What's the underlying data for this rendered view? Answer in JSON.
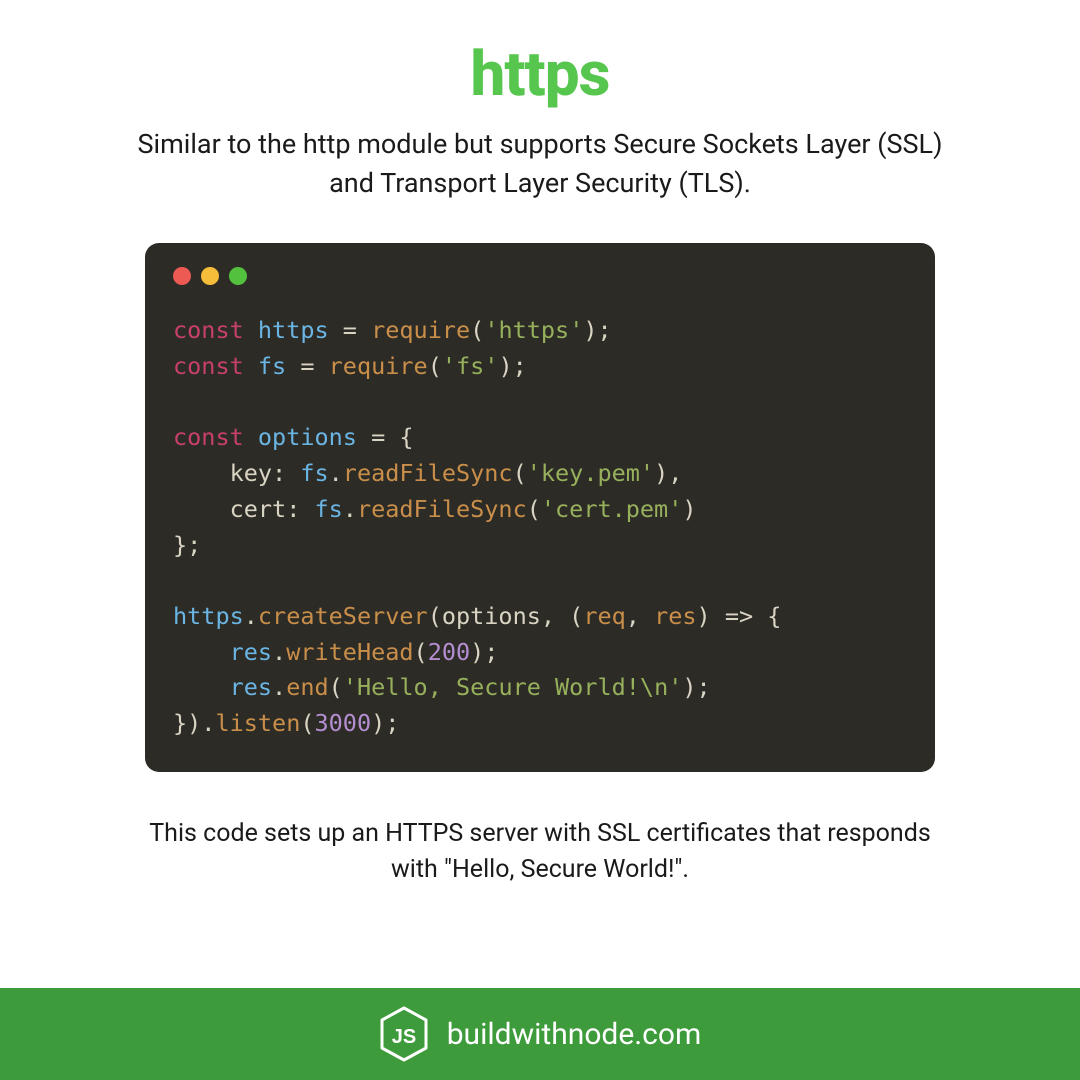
{
  "title": "https",
  "description": "Similar to the http module but supports Secure Sockets Layer (SSL) and Transport Layer Security (TLS).",
  "caption": "This code sets up an HTTPS server with SSL certificates that responds with \"Hello, Secure World!\".",
  "footer": {
    "site": "buildwithnode.com",
    "logo_text": "JS"
  },
  "code": {
    "line1": {
      "kw": "const",
      "name": "https",
      "eq": " = ",
      "fn": "require",
      "paren_o": "(",
      "str": "'https'",
      "paren_c": ");"
    },
    "line2": {
      "kw": "const",
      "name": "fs",
      "eq": " = ",
      "fn": "require",
      "paren_o": "(",
      "str": "'fs'",
      "paren_c": ");"
    },
    "line4": {
      "kw": "const",
      "name": "options",
      "eq": " = {"
    },
    "line5": {
      "indent": "    ",
      "prop": "key",
      "colon": ": ",
      "obj": "fs",
      "dot": ".",
      "fn": "readFileSync",
      "paren_o": "(",
      "str": "'key.pem'",
      "paren_c": "),"
    },
    "line6": {
      "indent": "    ",
      "prop": "cert",
      "colon": ": ",
      "obj": "fs",
      "dot": ".",
      "fn": "readFileSync",
      "paren_o": "(",
      "str": "'cert.pem'",
      "paren_c": ")"
    },
    "line7": {
      "close": "};"
    },
    "line9": {
      "obj": "https",
      "dot": ".",
      "fn": "createServer",
      "paren_o": "(",
      "arg1": "options",
      "comma": ", (",
      "req": "req",
      "comma2": ", ",
      "res": "res",
      "arrow": ") => {"
    },
    "line10": {
      "indent": "    ",
      "obj": "res",
      "dot": ".",
      "fn": "writeHead",
      "paren_o": "(",
      "num": "200",
      "paren_c": ");"
    },
    "line11": {
      "indent": "    ",
      "obj": "res",
      "dot": ".",
      "fn": "end",
      "paren_o": "(",
      "str": "'Hello, Secure World!\\n'",
      "paren_c": ");"
    },
    "line12": {
      "close": "}).",
      "fn": "listen",
      "paren_o": "(",
      "num": "3000",
      "paren_c": ");"
    }
  }
}
